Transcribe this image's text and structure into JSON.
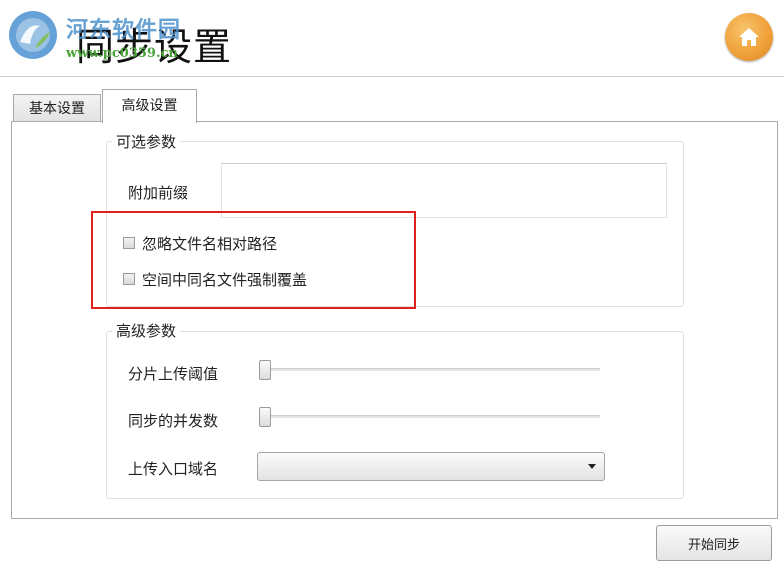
{
  "header": {
    "title": "同步设置",
    "watermark_text": "河东软件园",
    "watermark_url": "www.pc0359.cn",
    "logo_icon": "site-logo-icon",
    "home_icon": "home-icon",
    "home_color": "#f0a23b"
  },
  "tabs": [
    {
      "label": "基本设置",
      "active": false
    },
    {
      "label": "高级设置",
      "active": true
    }
  ],
  "optional_params": {
    "title": "可选参数",
    "prefix_label": "附加前缀",
    "prefix_value": "",
    "checkboxes": [
      {
        "label": "忽略文件名相对路径",
        "checked": false
      },
      {
        "label": "空间中同名文件强制覆盖",
        "checked": false
      }
    ],
    "highlight_color": "#e0201e"
  },
  "advanced_params": {
    "title": "高级参数",
    "chunk_threshold_label": "分片上传阈值",
    "chunk_threshold_value": 0,
    "concurrency_label": "同步的并发数",
    "concurrency_value": 0,
    "upload_domain_label": "上传入口域名",
    "upload_domain_value": ""
  },
  "footer": {
    "start_button_label": "开始同步"
  }
}
